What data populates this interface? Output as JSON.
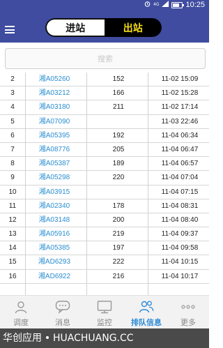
{
  "status": {
    "time": "10:25",
    "signal_label": "4G"
  },
  "appbar": {
    "tab_in": "进站",
    "tab_out": "出站"
  },
  "search": {
    "placeholder": "搜索"
  },
  "rows": [
    {
      "idx": "2",
      "plate": "湘A05260",
      "num": "152",
      "time": "11-02 15:09"
    },
    {
      "idx": "3",
      "plate": "湘A03212",
      "num": "166",
      "time": "11-02 15:28"
    },
    {
      "idx": "4",
      "plate": "湘A03180",
      "num": "211",
      "time": "11-02 17:14"
    },
    {
      "idx": "5",
      "plate": "湘A07090",
      "num": "",
      "time": "11-03 22:46"
    },
    {
      "idx": "6",
      "plate": "湘A05395",
      "num": "192",
      "time": "11-04 06:34"
    },
    {
      "idx": "7",
      "plate": "湘A08776",
      "num": "205",
      "time": "11-04 06:47"
    },
    {
      "idx": "8",
      "plate": "湘A05387",
      "num": "189",
      "time": "11-04 06:57"
    },
    {
      "idx": "9",
      "plate": "湘A05298",
      "num": "220",
      "time": "11-04 07:04"
    },
    {
      "idx": "10",
      "plate": "湘A03915",
      "num": "",
      "time": "11-04 07:15"
    },
    {
      "idx": "11",
      "plate": "湘A02340",
      "num": "178",
      "time": "11-04 08:31"
    },
    {
      "idx": "12",
      "plate": "湘A03148",
      "num": "200",
      "time": "11-04 08:40"
    },
    {
      "idx": "13",
      "plate": "湘A05916",
      "num": "219",
      "time": "11-04 09:37"
    },
    {
      "idx": "14",
      "plate": "湘A05385",
      "num": "197",
      "time": "11-04 09:58"
    },
    {
      "idx": "15",
      "plate": "湘AD6293",
      "num": "222",
      "time": "11-04 10:15"
    },
    {
      "idx": "16",
      "plate": "湘AD6922",
      "num": "216",
      "time": "11-04 10:17"
    }
  ],
  "bottom_nav": [
    {
      "label": "调度",
      "icon": "user-icon"
    },
    {
      "label": "消息",
      "icon": "chat-icon"
    },
    {
      "label": "监控",
      "icon": "monitor-icon"
    },
    {
      "label": "排队信息",
      "icon": "queue-people-icon",
      "active": true
    },
    {
      "label": "更多",
      "icon": "more-icon"
    }
  ],
  "watermark": {
    "left": "华创应用",
    "right": "HUACHUANG.CC"
  },
  "colors": {
    "appbar": "#3f4c9f",
    "active_nav": "#2f8bd6",
    "plate_text": "#2b8ed0",
    "out_tab_text": "#f7de18"
  }
}
